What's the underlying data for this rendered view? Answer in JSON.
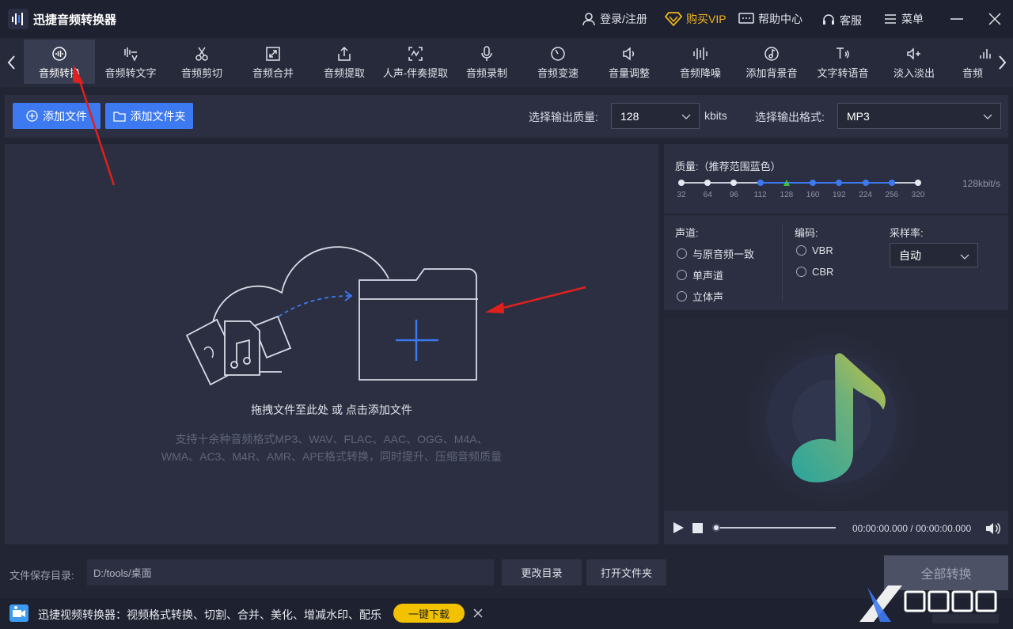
{
  "app": {
    "title": "迅捷音频转换器"
  },
  "titlebar": {
    "login": "登录/注册",
    "vip": "购买VIP",
    "help": "帮助中心",
    "service": "客服",
    "menu": "菜单"
  },
  "tools": [
    {
      "label": "音频转换",
      "icon": "audio-convert-icon"
    },
    {
      "label": "音频转文字",
      "icon": "speech-to-text-icon"
    },
    {
      "label": "音频剪切",
      "icon": "scissors-icon"
    },
    {
      "label": "音频合并",
      "icon": "merge-icon"
    },
    {
      "label": "音频提取",
      "icon": "extract-icon"
    },
    {
      "label": "人声-伴奏提取",
      "icon": "vocal-icon"
    },
    {
      "label": "音频录制",
      "icon": "microphone-icon"
    },
    {
      "label": "音频变速",
      "icon": "speed-icon"
    },
    {
      "label": "音量调整",
      "icon": "volume-icon"
    },
    {
      "label": "音频降噪",
      "icon": "denoise-icon"
    },
    {
      "label": "添加背景音",
      "icon": "bgm-icon"
    },
    {
      "label": "文字转语音",
      "icon": "text-to-speech-icon"
    },
    {
      "label": "淡入淡出",
      "icon": "fade-icon"
    },
    {
      "label": "音频",
      "icon": "audio-icon"
    }
  ],
  "actions": {
    "add_file": "添加文件",
    "add_folder": "添加文件夹",
    "quality_label": "选择输出质量:",
    "quality_value": "128",
    "quality_unit": "kbits",
    "format_label": "选择输出格式:",
    "format_value": "MP3"
  },
  "drop": {
    "hint": "拖拽文件至此处 或 点击添加文件",
    "sub1": "支持十余种音频格式MP3、WAV、FLAC、AAC、OGG、M4A、",
    "sub2": "WMA、AC3、M4R、AMR、APE格式转换，同时提升、压缩音频质量"
  },
  "quality": {
    "title": "质量:（推荐范围蓝色）",
    "current": "128kbit/s",
    "ticks": [
      "32",
      "64",
      "96",
      "112",
      "128",
      "160",
      "192",
      "224",
      "256",
      "320"
    ],
    "selected_index": 4,
    "recommended_range": [
      3,
      8
    ]
  },
  "options": {
    "channel_label": "声道:",
    "channels": [
      "与原音频一致",
      "单声道",
      "立体声"
    ],
    "encoding_label": "编码:",
    "encodings": [
      "VBR",
      "CBR"
    ],
    "samplerate_label": "采样率:",
    "samplerate_value": "自动"
  },
  "player": {
    "time": "00:00:00.000 / 00:00:00.000",
    "progress": 0
  },
  "bottom": {
    "save_label": "文件保存目录:",
    "save_path": "D:/tools/桌面",
    "change_dir": "更改目录",
    "open_folder": "打开文件夹",
    "convert_all": "全部转换"
  },
  "ad": {
    "text": "迅捷视频转换器：视频格式转换、切割、合并、美化、增减水印、配乐",
    "download": "一键下载"
  },
  "colors": {
    "accent": "#3d79f0",
    "vip": "#f2b51c",
    "annotation": "#e0201d"
  }
}
